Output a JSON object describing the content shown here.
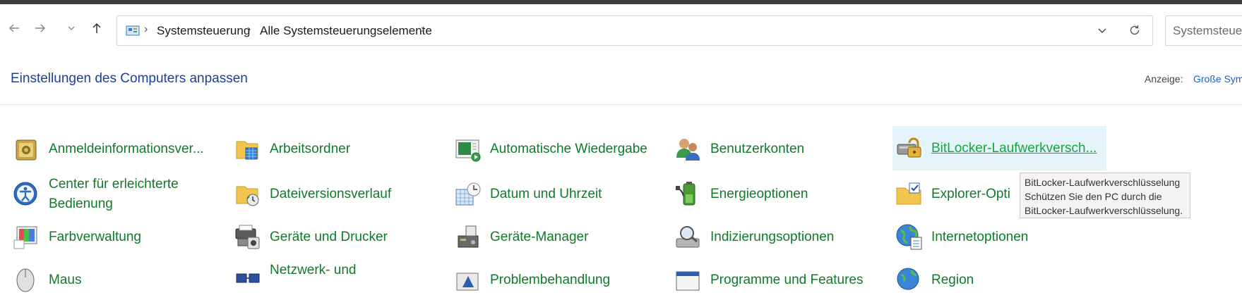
{
  "nav": {
    "address_crumbs": [
      "Systemsteuerung",
      "Alle Systemsteuerungselemente"
    ],
    "search_placeholder": "Systemsteuer"
  },
  "header": {
    "title": "Einstellungen des Computers anpassen",
    "view_label": "Anzeige:",
    "view_value": "Große Sym"
  },
  "items": [
    {
      "label": "Anmeldeinformationsver...",
      "icon": "credential-manager-icon"
    },
    {
      "label": "Arbeitsordner",
      "icon": "work-folders-icon"
    },
    {
      "label": "Automatische Wiedergabe",
      "icon": "autoplay-icon"
    },
    {
      "label": "Benutzerkonten",
      "icon": "user-accounts-icon"
    },
    {
      "label": "BitLocker-Laufwerkversch...",
      "icon": "bitlocker-icon"
    },
    {
      "label": "Center für erleichterte",
      "label2": "Bedienung",
      "icon": "ease-of-access-icon"
    },
    {
      "label": "Dateiversionsverlauf",
      "icon": "file-history-icon"
    },
    {
      "label": "Datum und Uhrzeit",
      "icon": "date-time-icon"
    },
    {
      "label": "Energieoptionen",
      "icon": "power-options-icon"
    },
    {
      "label": "Explorer-Opti",
      "icon": "explorer-options-icon"
    },
    {
      "label": "Farbverwaltung",
      "icon": "color-management-icon"
    },
    {
      "label": "Geräte und Drucker",
      "icon": "devices-printers-icon"
    },
    {
      "label": "Geräte-Manager",
      "icon": "device-manager-icon"
    },
    {
      "label": "Indizierungsoptionen",
      "icon": "indexing-options-icon"
    },
    {
      "label": "Internetoptionen",
      "icon": "internet-options-icon"
    },
    {
      "label": "Maus",
      "icon": "mouse-icon"
    },
    {
      "label": "Netzwerk- und",
      "icon": "network-center-icon"
    },
    {
      "label": "Problembehandlung",
      "icon": "troubleshooting-icon"
    },
    {
      "label": "Programme und Features",
      "icon": "programs-features-icon"
    },
    {
      "label": "Region",
      "icon": "region-icon"
    }
  ],
  "tooltip": {
    "title": "BitLocker-Laufwerkverschlüsselung",
    "line1": "Schützen Sie den PC durch die",
    "line2": "BitLocker-Laufwerkverschlüsselung."
  }
}
